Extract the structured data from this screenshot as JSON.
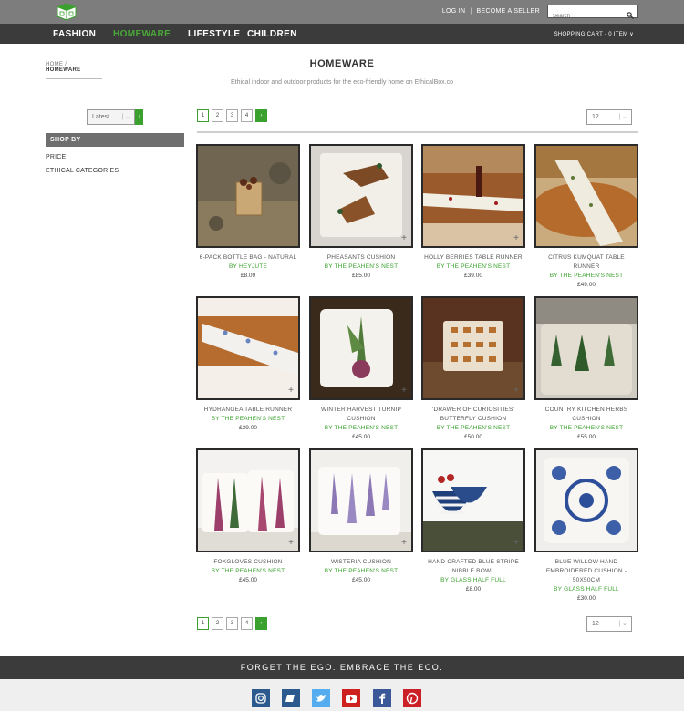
{
  "header": {
    "login": "LOG IN",
    "become_seller": "BECOME A SELLER",
    "search_placeholder": "Search",
    "cart": "SHOPPING CART - 0 ITEM ∨"
  },
  "nav": {
    "items": [
      {
        "label": "FASHION"
      },
      {
        "label": "HOMEWARE"
      },
      {
        "label": "LIFESTYLE"
      },
      {
        "label": "CHILDREN"
      }
    ]
  },
  "breadcrumb": {
    "home": "HOME",
    "sep": "/",
    "current": "HOMEWARE"
  },
  "page": {
    "title": "HOMEWARE",
    "subtitle": "Ethical indoor and outdoor products for the eco-friendly home on EthicalBox.co"
  },
  "sidebar": {
    "sort_value": "Latest",
    "shop_by": "SHOP BY",
    "filters": [
      {
        "label": "PRICE"
      },
      {
        "label": "ETHICAL CATEGORIES"
      }
    ]
  },
  "pagination": {
    "pages": [
      "1",
      "2",
      "3",
      "4"
    ],
    "next": "›",
    "per_page": "12"
  },
  "products": [
    {
      "name": "6-PACK BOTTLE BAG - NATURAL",
      "seller": "BY HEYJUTE",
      "price": "£8.09"
    },
    {
      "name": "PHEASANTS CUSHION",
      "seller": "BY THE PEAHEN'S NEST",
      "price": "£85.00"
    },
    {
      "name": "HOLLY BERRIES TABLE RUNNER",
      "seller": "BY THE PEAHEN'S NEST",
      "price": "£39.00"
    },
    {
      "name": "CITRUS KUMQUAT TABLE RUNNER",
      "seller": "BY THE PEAHEN'S NEST",
      "price": "£49.00"
    },
    {
      "name": "HYDRANGEA TABLE RUNNER",
      "seller": "BY THE PEAHEN'S NEST",
      "price": "£39.00"
    },
    {
      "name": "WINTER HARVEST TURNIP CUSHION",
      "seller": "BY THE PEAHEN'S NEST",
      "price": "£45.00"
    },
    {
      "name": "'DRAWER OF CURIOSITIES' BUTTERFLY CUSHION",
      "seller": "BY THE PEAHEN'S NEST",
      "price": "£50.00"
    },
    {
      "name": "COUNTRY KITCHEN HERBS CUSHION",
      "seller": "BY THE PEAHEN'S NEST",
      "price": "£55.00"
    },
    {
      "name": "FOXGLOVES CUSHION",
      "seller": "BY THE PEAHEN'S NEST",
      "price": "£45.00"
    },
    {
      "name": "WISTERIA CUSHION",
      "seller": "BY THE PEAHEN'S NEST",
      "price": "£45.00"
    },
    {
      "name": "HAND CRAFTED BLUE STRIPE NIBBLE BOWL",
      "seller": "BY GLASS HALF FULL",
      "price": "£8.00"
    },
    {
      "name": "BLUE WILLOW HAND EMBROIDERED CUSHION - 50X50CM",
      "seller": "BY GLASS HALF FULL",
      "price": "£30.00"
    }
  ],
  "footer": {
    "tagline": "FORGET THE EGO. EMBRACE THE ECO.",
    "social": [
      {
        "icon": "instagram-icon",
        "color": "#2d5a8e"
      },
      {
        "icon": "blog-icon",
        "color": "#2d5a8e"
      },
      {
        "icon": "twitter-icon",
        "color": "#55acee"
      },
      {
        "icon": "youtube-icon",
        "color": "#cd201f"
      },
      {
        "icon": "facebook-icon",
        "color": "#3b5998"
      },
      {
        "icon": "pinterest-icon",
        "color": "#cb2027"
      }
    ]
  },
  "colors": {
    "accent": "#3aa12e",
    "dark": "#3b3b3b",
    "topbar": "#7d7d7d"
  }
}
